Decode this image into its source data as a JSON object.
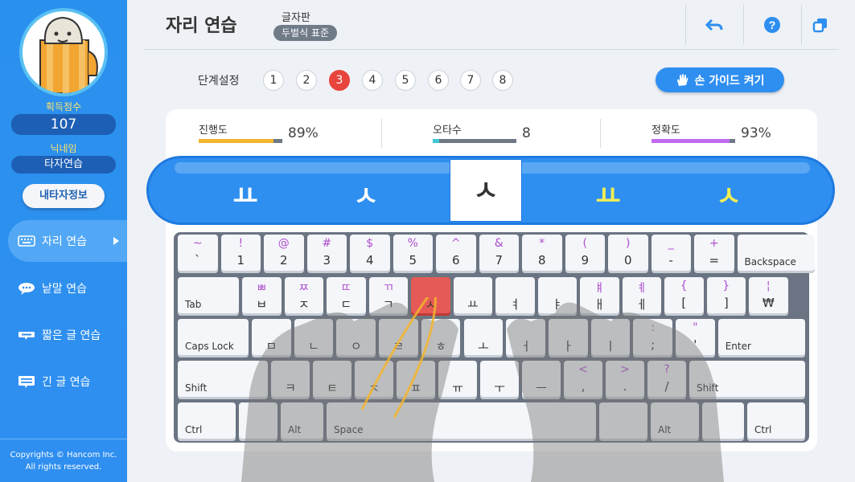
{
  "sidebar": {
    "score_label": "획득점수",
    "score": "107",
    "nick_label": "닉네임",
    "nick": "타자연습",
    "my_info": "내타자정보",
    "nav": [
      {
        "label": "자리 연습"
      },
      {
        "label": "낱말 연습"
      },
      {
        "label": "짧은 글 연습"
      },
      {
        "label": "긴 글 연습"
      }
    ],
    "copyright1": "Copyrights © Hancom Inc.",
    "copyright2": "All rights reserved."
  },
  "header": {
    "title": "자리 연습",
    "layout_label": "글자판",
    "layout_value": "두벌식 표준"
  },
  "stages": {
    "label": "단계설정",
    "items": [
      "1",
      "2",
      "3",
      "4",
      "5",
      "6",
      "7",
      "8"
    ],
    "active": "3"
  },
  "guide_button": "손 가이드 켜기",
  "stats": [
    {
      "label": "진행도",
      "value": "89%",
      "fill": 0.89,
      "color": "#f3b52e"
    },
    {
      "label": "오타수",
      "value": "8",
      "fill": 0.08,
      "color": "#3dc8d8"
    },
    {
      "label": "정확도",
      "value": "93%",
      "fill": 0.93,
      "color": "#c26cf0"
    }
  ],
  "strip": [
    {
      "ch": "ㅛ",
      "state": "done"
    },
    {
      "ch": "ㅅ",
      "state": "done"
    },
    {
      "ch": "ㅅ",
      "state": "current"
    },
    {
      "ch": "ㅛ",
      "state": "ahead"
    },
    {
      "ch": "ㅅ",
      "state": "ahead"
    }
  ],
  "keyboard": {
    "row1": [
      [
        "~",
        "`"
      ],
      [
        "!",
        "1"
      ],
      [
        "@",
        "2"
      ],
      [
        "#",
        "3"
      ],
      [
        "$",
        "4"
      ],
      [
        "%",
        "5"
      ],
      [
        "^",
        "6"
      ],
      [
        "&",
        "7"
      ],
      [
        "*",
        "8"
      ],
      [
        "(",
        "9"
      ],
      [
        ")",
        "0"
      ],
      [
        "_",
        "-"
      ],
      [
        "+",
        "="
      ]
    ],
    "backspace": "Backspace",
    "tab": "Tab",
    "row2": [
      [
        "ㅃ",
        "ㅂ"
      ],
      [
        "ㅉ",
        "ㅈ"
      ],
      [
        "ㄸ",
        "ㄷ"
      ],
      [
        "ㄲ",
        "ㄱ"
      ],
      [
        "",
        "ㅅ"
      ],
      [
        "",
        "ㅛ"
      ],
      [
        "",
        "ㅕ"
      ],
      [
        "",
        "ㅑ"
      ],
      [
        "ㅒ",
        "ㅐ"
      ],
      [
        "ㅖ",
        "ㅔ"
      ],
      [
        "{",
        "["
      ],
      [
        "}",
        "]"
      ],
      [
        "¦",
        "₩"
      ]
    ],
    "caps": "Caps Lock",
    "row3": [
      [
        "",
        "ㅁ"
      ],
      [
        "",
        "ㄴ"
      ],
      [
        "",
        "ㅇ"
      ],
      [
        "",
        "ㄹ"
      ],
      [
        "",
        "ㅎ"
      ],
      [
        "",
        "ㅗ"
      ],
      [
        "",
        "ㅓ"
      ],
      [
        "",
        "ㅏ"
      ],
      [
        "",
        "ㅣ"
      ],
      [
        ":",
        ";"
      ],
      [
        "\"",
        "'"
      ]
    ],
    "enter": "Enter",
    "shift": "Shift",
    "row4": [
      [
        "",
        "ㅋ"
      ],
      [
        "",
        "ㅌ"
      ],
      [
        "",
        "ㅊ"
      ],
      [
        "",
        "ㅍ"
      ],
      [
        "",
        "ㅠ"
      ],
      [
        "",
        "ㅜ"
      ],
      [
        "",
        "ㅡ"
      ],
      [
        "<",
        ","
      ],
      [
        ">",
        "."
      ],
      [
        "?",
        "/"
      ]
    ],
    "ctrl": "Ctrl",
    "alt": "Alt",
    "space": "Space"
  }
}
